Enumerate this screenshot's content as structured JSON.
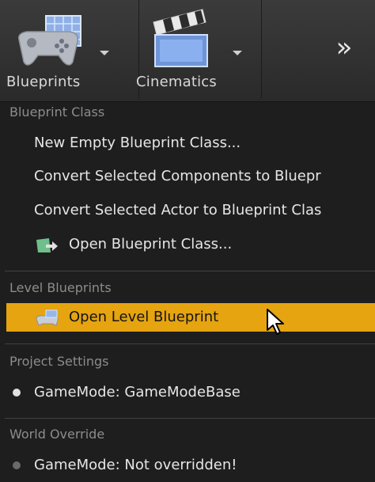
{
  "toolbar": {
    "blueprints_label": "Blueprints",
    "cinematics_label": "Cinematics",
    "overflow_glyph": "»"
  },
  "menu": {
    "sections": [
      {
        "header": "Blueprint Class",
        "items": [
          {
            "label": "New Empty Blueprint Class..."
          },
          {
            "label": "Convert Selected Components to Bluepr"
          },
          {
            "label": "Convert Selected Actor to Blueprint Clas"
          },
          {
            "label": "Open Blueprint Class...",
            "icon": "open-blueprint-class-icon"
          }
        ]
      },
      {
        "header": "Level Blueprints",
        "items": [
          {
            "label": "Open Level Blueprint",
            "icon": "level-blueprint-icon",
            "highlighted": true
          }
        ]
      },
      {
        "header": "Project Settings",
        "items": [
          {
            "label": "GameMode: GameModeBase",
            "icon": "bullet-icon"
          }
        ]
      },
      {
        "header": "World Override",
        "items": [
          {
            "label": "GameMode: Not overridden!",
            "icon": "bullet-icon-dim"
          }
        ]
      }
    ]
  },
  "colors": {
    "highlight": "#e5a410",
    "menu_background": "#1e1e1e",
    "toolbar_background": "#333333",
    "text": "#e6e6e6",
    "section_header_text": "#8c8c8c"
  }
}
